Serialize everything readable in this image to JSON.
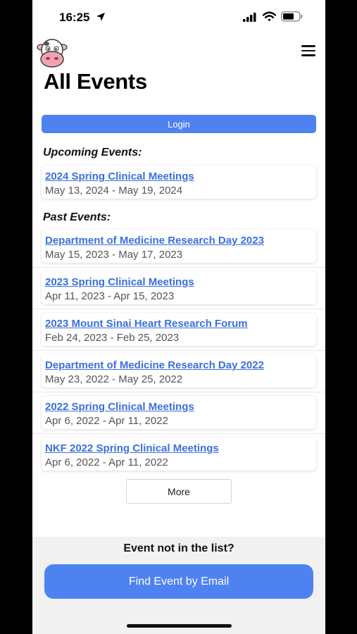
{
  "status_bar": {
    "time": "16:25",
    "location_icon": "location-arrow-icon",
    "signal_icon": "cellular-signal-icon",
    "wifi_icon": "wifi-icon",
    "battery_icon": "battery-icon"
  },
  "header": {
    "logo_icon": "cow-logo-icon",
    "menu_icon": "hamburger-menu-icon",
    "title": "All Events"
  },
  "login_label": "Login",
  "upcoming": {
    "heading": "Upcoming Events:",
    "events": [
      {
        "name": "2024 Spring Clinical Meetings",
        "dates": "May 13, 2024 - May 19, 2024"
      }
    ]
  },
  "past": {
    "heading": "Past Events:",
    "events": [
      {
        "name": "Department of Medicine Research Day 2023",
        "dates": "May 15, 2023 - May 17, 2023"
      },
      {
        "name": "2023 Spring Clinical Meetings",
        "dates": "Apr 11, 2023 - Apr 15, 2023"
      },
      {
        "name": "2023 Mount Sinai Heart Research Forum",
        "dates": "Feb 24, 2023 - Feb 25, 2023"
      },
      {
        "name": "Department of Medicine Research Day 2022",
        "dates": "May 23, 2022 - May 25, 2022"
      },
      {
        "name": "2022 Spring Clinical Meetings",
        "dates": "Apr 6, 2022 - Apr 11, 2022"
      },
      {
        "name": "NKF 2022 Spring Clinical Meetings",
        "dates": "Apr 6, 2022 - Apr 11, 2022"
      }
    ]
  },
  "more_label": "More",
  "footer": {
    "question": "Event not in the list?",
    "find_label": "Find Event by Email"
  },
  "colors": {
    "accent": "#4f82f1",
    "link": "#3a6fe0",
    "footer_bg": "#f1f1f1"
  }
}
